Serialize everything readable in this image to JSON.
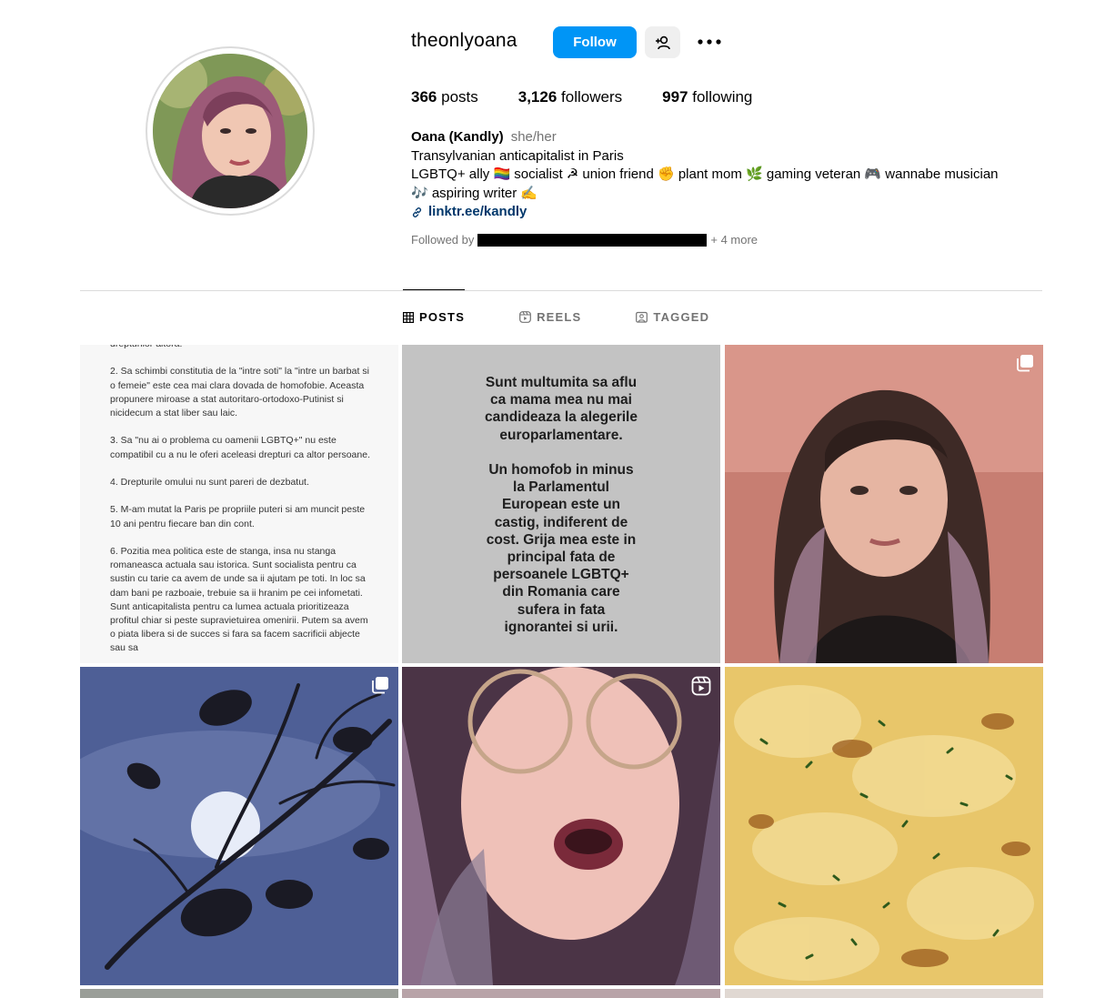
{
  "profile": {
    "username": "theonlyoana",
    "follow_label": "Follow",
    "stats": {
      "posts_count": "366",
      "posts_label": "posts",
      "followers_count": "3,126",
      "followers_label": "followers",
      "following_count": "997",
      "following_label": "following"
    },
    "bio": {
      "name": "Oana (Kandly)",
      "pronouns": "she/her",
      "line1": "Transylvanian anticapitalist in Paris",
      "line2": "LGBTQ+ ally 🏳️‍🌈 socialist ☭ union friend ✊ plant mom 🌿 gaming veteran 🎮 wannabe musician",
      "line3": "🎶 aspiring writer ✍️",
      "link": "linktr.ee/kandly"
    },
    "followed_by_prefix": "Followed by",
    "followed_by_suffix": "+ 4 more"
  },
  "tabs": [
    {
      "label": "POSTS",
      "icon": "grid-icon",
      "active": true
    },
    {
      "label": "REELS",
      "icon": "reels-icon",
      "active": false
    },
    {
      "label": "TAGGED",
      "icon": "tagged-icon",
      "active": false
    }
  ],
  "posts": {
    "post1_text": "drepturilor altora.\n\n2. Sa schimbi constitutia de la \"intre soti\" la \"intre un barbat si o femeie\" este cea mai clara dovada de homofobie. Aceasta propunere miroase a stat autoritaro-ortodoxo-Putinist si nicidecum a stat liber sau laic.\n\n3. Sa \"nu ai o problema cu oamenii LGBTQ+\" nu este compatibil cu a nu le oferi aceleasi drepturi ca altor persoane.\n\n4. Drepturile omului nu sunt pareri de dezbatut.\n\n5. M-am mutat la Paris pe propriile puteri si am muncit peste 10 ani pentru fiecare ban din cont.\n\n6. Pozitia mea politica este de stanga, insa nu stanga romaneasca actuala sau istorica. Sunt socialista pentru ca sustin cu tarie ca avem de unde sa ii ajutam pe toti. In loc sa dam bani pe razboaie, trebuie sa ii hranim pe cei infometati. Sunt anticapitalista pentru ca lumea actuala prioritizeaza profitul chiar si peste supravietuirea omenirii. Putem sa avem o piata libera si de succes si fara sa facem sacrificii abjecte sau sa",
    "post2_text": "Sunt multumita sa aflu\nca mama mea nu mai\ncandideaza la alegerile\neuroparlamentare.\n\nUn homofob in minus\nla Parlamentul\nEuropean este un\ncastig, indiferent de\ncost. Grija mea este in\nprincipal fata de\npersoanele LGBTQ+\ndin Romania care\nsufera in fata\nignorantei si urii."
  },
  "colors": {
    "accent": "#0095f6",
    "link": "#00376b",
    "muted": "#737373",
    "divider": "#dbdbdb"
  }
}
